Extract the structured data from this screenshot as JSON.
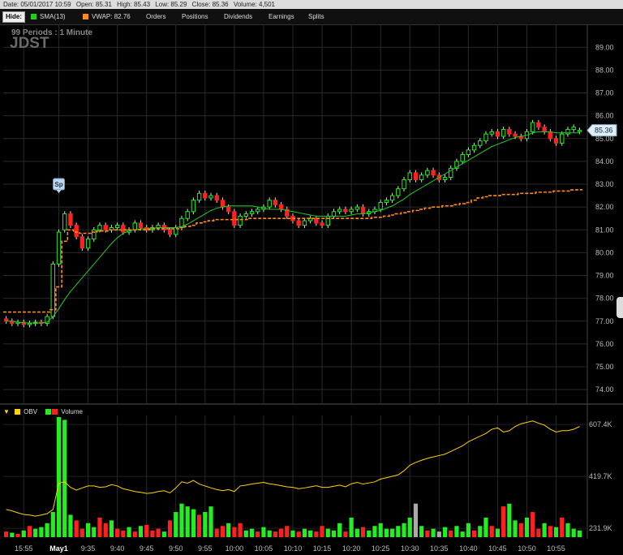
{
  "infobar": {
    "date": "Date: 05/01/2017 10:59",
    "open": "Open: 85.31",
    "high": "High: 85.43",
    "low": "Low: 85.29",
    "close": "Close: 85.36",
    "volume": "Volume: 4,501"
  },
  "menu": {
    "hide": "Hide:",
    "sma": "SMA(13)",
    "vwap": "VWAP: 82.76",
    "items": [
      "Orders",
      "Positions",
      "Dividends",
      "Earnings",
      "Splits"
    ]
  },
  "chart_data": [
    {
      "type": "candlestick",
      "symbol": "JDST",
      "subtitle": "99  Periods : 1 Minute",
      "ylim": [
        73.4,
        89.9
      ],
      "y_ticks": [
        74,
        75,
        76,
        77,
        78,
        79,
        80,
        81,
        82,
        83,
        84,
        85,
        86,
        87,
        88,
        89
      ],
      "y_tick_labels": [
        "74.00",
        "75.00",
        "76.00",
        "77.00",
        "78.00",
        "79.00",
        "80.00",
        "81.00",
        "82.00",
        "83.00",
        "84.00",
        "85.00",
        "86.00",
        "87.00",
        "88.00",
        "89.00"
      ],
      "x_tick_labels": [
        "15:55",
        "May1",
        "9:35",
        "9:40",
        "9:45",
        "9:50",
        "9:55",
        "10:00",
        "10:05",
        "10:10",
        "10:15",
        "10:20",
        "10:25",
        "10:30",
        "10:35",
        "10:40",
        "10:45",
        "10:50",
        "10:55"
      ],
      "x_tick_index": [
        3,
        9,
        14,
        19,
        24,
        29,
        34,
        39,
        44,
        49,
        54,
        59,
        64,
        69,
        74,
        79,
        84,
        89,
        94
      ],
      "marker": {
        "label": "Sp",
        "index": 9
      },
      "current_price_label": "85.36",
      "series": [
        {
          "name": "SMA(13)",
          "color": "#22cc22"
        },
        {
          "name": "VWAP",
          "color": "#ff8c1a"
        }
      ],
      "close": [
        77.0,
        76.9,
        76.95,
        76.85,
        76.9,
        76.95,
        76.9,
        77.2,
        79.5,
        80.9,
        81.7,
        81.2,
        80.7,
        80.2,
        80.6,
        81.0,
        81.2,
        81.0,
        81.1,
        81.2,
        80.9,
        81.0,
        81.3,
        81.1,
        81.0,
        81.1,
        81.2,
        81.0,
        80.8,
        81.1,
        81.5,
        81.8,
        82.3,
        82.6,
        82.4,
        82.5,
        82.3,
        82.0,
        81.8,
        81.2,
        81.6,
        81.7,
        81.8,
        81.9,
        82.0,
        82.3,
        82.1,
        81.9,
        81.6,
        81.4,
        81.2,
        81.4,
        81.5,
        81.3,
        81.2,
        81.6,
        81.8,
        81.9,
        81.8,
        81.9,
        82.0,
        81.7,
        81.8,
        81.9,
        82.2,
        82.3,
        82.5,
        82.8,
        83.2,
        83.5,
        83.2,
        83.4,
        83.6,
        83.4,
        83.2,
        83.3,
        83.7,
        84.0,
        84.3,
        84.5,
        84.7,
        84.9,
        85.2,
        85.3,
        85.1,
        85.4,
        85.2,
        85.1,
        85.0,
        85.3,
        85.7,
        85.5,
        85.3,
        85.0,
        84.8,
        85.2,
        85.4,
        85.5,
        85.36
      ],
      "open": [
        77.1,
        77.0,
        76.9,
        76.95,
        76.85,
        76.9,
        76.95,
        76.9,
        77.2,
        79.5,
        81.0,
        81.7,
        81.2,
        80.7,
        80.2,
        80.6,
        81.0,
        81.2,
        81.0,
        81.1,
        81.2,
        80.9,
        81.0,
        81.3,
        81.1,
        81.0,
        81.1,
        81.2,
        81.0,
        80.8,
        81.1,
        81.5,
        81.8,
        82.3,
        82.6,
        82.4,
        82.5,
        82.3,
        82.0,
        81.8,
        81.2,
        81.6,
        81.7,
        81.8,
        81.9,
        82.0,
        82.3,
        82.1,
        81.9,
        81.6,
        81.4,
        81.2,
        81.4,
        81.5,
        81.3,
        81.2,
        81.6,
        81.8,
        81.9,
        81.8,
        81.9,
        82.0,
        81.7,
        81.8,
        81.9,
        82.2,
        82.3,
        82.5,
        82.8,
        83.2,
        83.5,
        83.2,
        83.4,
        83.6,
        83.4,
        83.2,
        83.3,
        83.7,
        84.0,
        84.3,
        84.5,
        84.7,
        84.9,
        85.2,
        85.3,
        85.1,
        85.4,
        85.2,
        85.1,
        85.0,
        85.3,
        85.7,
        85.5,
        85.3,
        85.0,
        84.8,
        85.2,
        85.4,
        85.31
      ],
      "sma13": [
        77.0,
        77.0,
        76.95,
        76.93,
        76.92,
        76.92,
        76.92,
        76.95,
        77.2,
        77.55,
        77.95,
        78.3,
        78.6,
        78.9,
        79.2,
        79.5,
        79.8,
        80.1,
        80.4,
        80.65,
        80.85,
        80.95,
        81.0,
        81.05,
        81.05,
        81.05,
        81.1,
        81.1,
        81.1,
        81.1,
        81.15,
        81.25,
        81.4,
        81.55,
        81.7,
        81.85,
        81.95,
        82.0,
        82.05,
        82.05,
        82.05,
        82.05,
        82.05,
        82.0,
        81.95,
        81.9,
        81.9,
        81.9,
        81.85,
        81.8,
        81.75,
        81.7,
        81.65,
        81.6,
        81.6,
        81.6,
        81.6,
        81.6,
        81.6,
        81.65,
        81.7,
        81.7,
        81.75,
        81.8,
        81.85,
        81.95,
        82.05,
        82.2,
        82.35,
        82.55,
        82.7,
        82.85,
        83.0,
        83.15,
        83.3,
        83.45,
        83.6,
        83.75,
        83.9,
        84.05,
        84.2,
        84.35,
        84.5,
        84.65,
        84.75,
        84.85,
        84.95,
        85.05,
        85.1,
        85.15,
        85.25,
        85.3,
        85.3,
        85.3,
        85.25,
        85.25,
        85.25,
        85.25,
        85.25
      ],
      "vwap": [
        77.4,
        77.4,
        77.4,
        77.4,
        77.4,
        77.4,
        77.4,
        77.4,
        77.5,
        78.5,
        80.5,
        81.0,
        80.9,
        80.85,
        80.85,
        80.9,
        80.95,
        80.95,
        81.0,
        81.0,
        81.0,
        81.0,
        81.0,
        81.0,
        81.0,
        81.05,
        81.05,
        81.05,
        81.05,
        81.05,
        81.1,
        81.15,
        81.2,
        81.3,
        81.35,
        81.4,
        81.45,
        81.45,
        81.45,
        81.45,
        81.45,
        81.45,
        81.5,
        81.5,
        81.5,
        81.5,
        81.5,
        81.5,
        81.5,
        81.5,
        81.5,
        81.5,
        81.5,
        81.5,
        81.5,
        81.5,
        81.5,
        81.5,
        81.5,
        81.5,
        81.5,
        81.5,
        81.5,
        81.55,
        81.55,
        81.6,
        81.65,
        81.7,
        81.75,
        81.8,
        81.85,
        81.9,
        81.95,
        82.0,
        82.0,
        82.05,
        82.05,
        82.1,
        82.15,
        82.2,
        82.3,
        82.4,
        82.45,
        82.5,
        82.5,
        82.55,
        82.55,
        82.55,
        82.6,
        82.6,
        82.6,
        82.65,
        82.65,
        82.65,
        82.7,
        82.7,
        82.7,
        82.75,
        82.76
      ]
    },
    {
      "type": "bar+line",
      "series": [
        {
          "name": "OBV",
          "color": "#ffd400"
        },
        {
          "name": "Volume",
          "color": "#ff2020"
        }
      ],
      "ylim": [
        200,
        640
      ],
      "y_ticks": [
        231.9,
        419.7,
        607.4
      ],
      "y_tick_labels": [
        "231.9K",
        "419.7K",
        "607.4K"
      ],
      "volume_note": "volume bars scaled to panel height",
      "volume": [
        10,
        8,
        6,
        12,
        20,
        15,
        18,
        25,
        45,
        215,
        210,
        40,
        30,
        15,
        25,
        18,
        35,
        25,
        30,
        15,
        12,
        18,
        10,
        20,
        22,
        12,
        15,
        10,
        30,
        45,
        60,
        55,
        50,
        40,
        45,
        55,
        15,
        20,
        25,
        18,
        25,
        12,
        15,
        10,
        18,
        12,
        10,
        15,
        20,
        12,
        10,
        15,
        12,
        10,
        20,
        15,
        12,
        25,
        10,
        35,
        15,
        18,
        12,
        20,
        25,
        15,
        15,
        20,
        25,
        35,
        60,
        20,
        12,
        15,
        10,
        18,
        12,
        20,
        10,
        25,
        12,
        20,
        35,
        20,
        15,
        55,
        60,
        30,
        25,
        35,
        45,
        15,
        25,
        20,
        18,
        35,
        25,
        15,
        12
      ],
      "volume_colors": [
        "r",
        "g",
        "r",
        "g",
        "r",
        "g",
        "g",
        "g",
        "g",
        "g",
        "g",
        "g",
        "r",
        "r",
        "g",
        "g",
        "r",
        "r",
        "g",
        "r",
        "r",
        "g",
        "r",
        "g",
        "r",
        "r",
        "r",
        "g",
        "r",
        "g",
        "g",
        "g",
        "g",
        "r",
        "g",
        "g",
        "r",
        "r",
        "g",
        "r",
        "r",
        "g",
        "g",
        "r",
        "g",
        "g",
        "r",
        "r",
        "r",
        "g",
        "r",
        "g",
        "g",
        "r",
        "r",
        "g",
        "g",
        "g",
        "r",
        "g",
        "g",
        "r",
        "g",
        "g",
        "g",
        "g",
        "g",
        "g",
        "g",
        "g",
        "s",
        "g",
        "r",
        "g",
        "s",
        "g",
        "r",
        "g",
        "g",
        "g",
        "r",
        "g",
        "g",
        "r",
        "g",
        "r",
        "g",
        "g",
        "r",
        "g",
        "r",
        "r",
        "g",
        "r",
        "g",
        "r",
        "g",
        "g",
        "g"
      ],
      "obv": [
        300,
        295,
        288,
        282,
        280,
        276,
        280,
        285,
        300,
        395,
        400,
        380,
        370,
        378,
        385,
        385,
        380,
        382,
        390,
        385,
        375,
        370,
        365,
        362,
        358,
        360,
        365,
        368,
        360,
        378,
        400,
        395,
        405,
        392,
        385,
        378,
        372,
        368,
        372,
        365,
        385,
        388,
        392,
        395,
        398,
        393,
        390,
        386,
        382,
        380,
        375,
        378,
        382,
        386,
        380,
        380,
        384,
        388,
        382,
        393,
        398,
        392,
        396,
        400,
        410,
        415,
        420,
        425,
        440,
        460,
        470,
        478,
        485,
        490,
        495,
        500,
        510,
        520,
        530,
        545,
        555,
        565,
        575,
        590,
        595,
        580,
        585,
        600,
        610,
        615,
        620,
        612,
        605,
        590,
        580,
        585,
        585,
        590,
        600
      ]
    }
  ]
}
